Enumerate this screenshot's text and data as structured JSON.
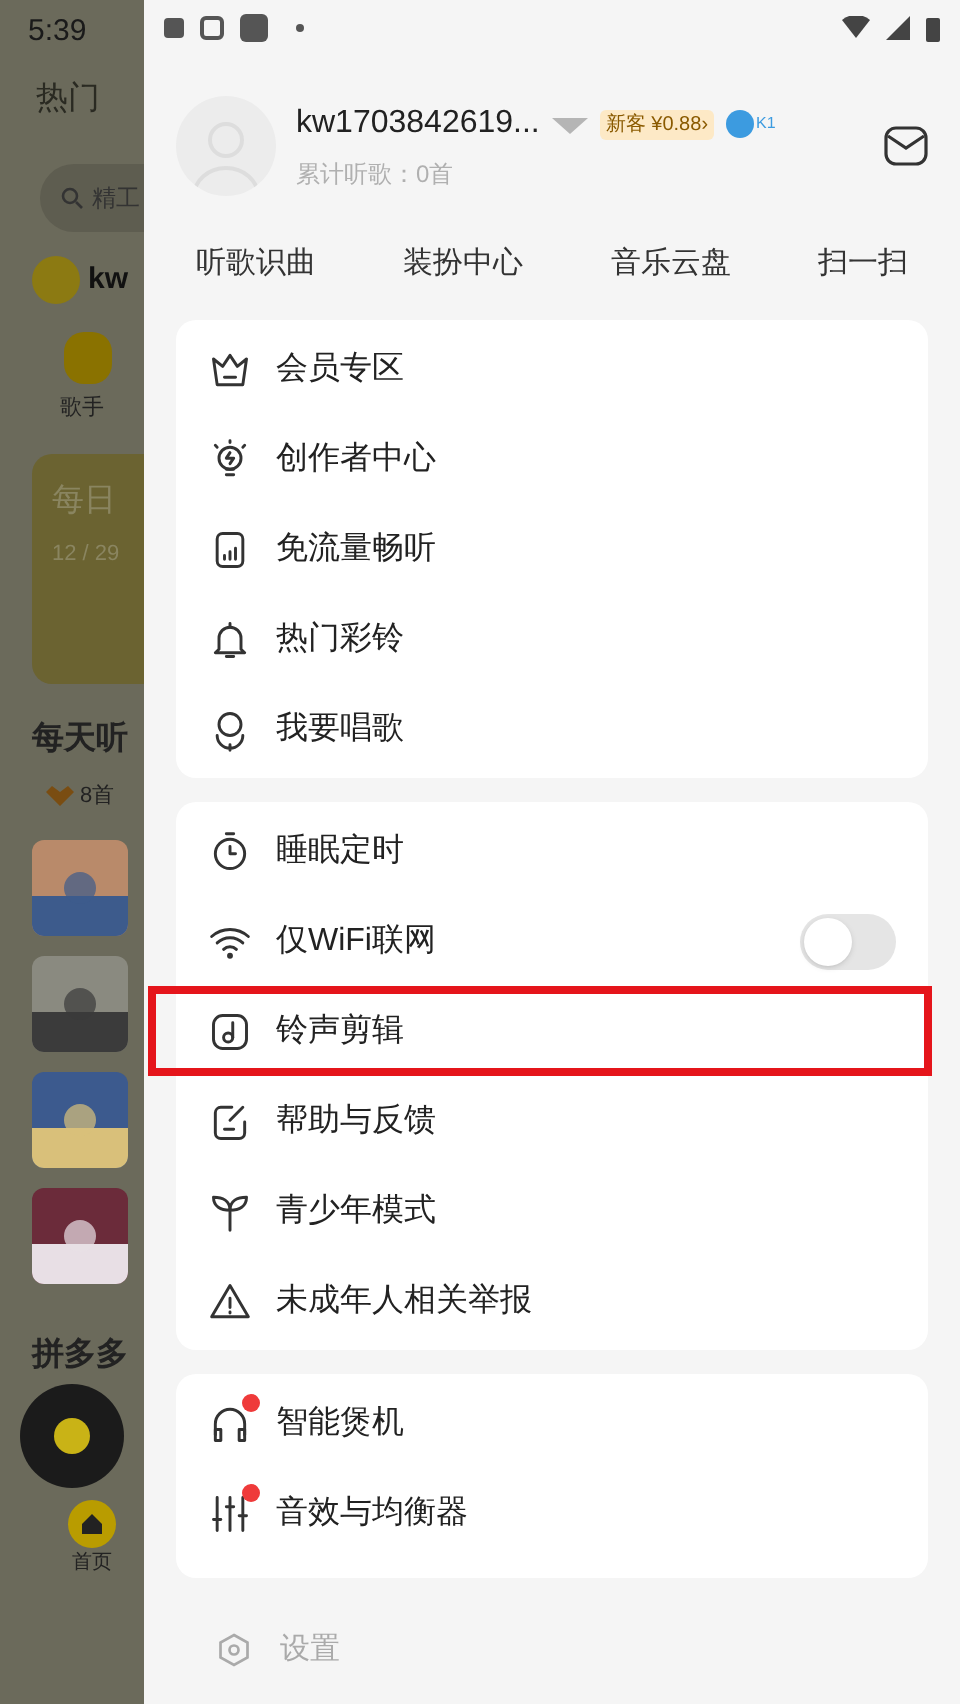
{
  "status_bar": {
    "time": "5:39"
  },
  "background_app": {
    "tab": "热门",
    "search": "精工",
    "user": "kw",
    "category": "歌手",
    "card_title": "每日",
    "card_date": "12 / 29",
    "section": "每天听",
    "count": "8首",
    "section_2": "拼多多",
    "nav": {
      "label": "首页",
      "selected": true
    }
  },
  "profile": {
    "username": "kw1703842619...",
    "promo": "新客 ¥0.88",
    "promo_arrow": "›",
    "level": "K1",
    "subtitle": "累计听歌：0首"
  },
  "quick_links": [
    "听歌识曲",
    "装扮中心",
    "音乐云盘",
    "扫一扫"
  ],
  "groups": [
    {
      "items": [
        {
          "label": "会员专区",
          "dot": false,
          "highlighted": false
        },
        {
          "label": "创作者中心",
          "dot": false,
          "highlighted": false
        },
        {
          "label": "免流量畅听",
          "dot": false,
          "highlighted": false
        },
        {
          "label": "热门彩铃",
          "dot": false,
          "highlighted": false
        },
        {
          "label": "我要唱歌",
          "dot": false,
          "highlighted": false
        }
      ]
    },
    {
      "items": [
        {
          "label": "睡眠定时",
          "dot": false,
          "highlighted": false
        },
        {
          "label": "仅WiFi联网",
          "dot": false,
          "highlighted": false,
          "on": false
        },
        {
          "label": "铃声剪辑",
          "dot": false,
          "highlighted": true
        },
        {
          "label": "帮助与反馈",
          "dot": false,
          "highlighted": false
        },
        {
          "label": "青少年模式",
          "dot": false,
          "highlighted": false
        },
        {
          "label": "未成年人相关举报",
          "dot": false,
          "highlighted": false
        }
      ]
    },
    {
      "items": [
        {
          "label": "智能煲机",
          "dot": true,
          "highlighted": false
        },
        {
          "label": "音效与均衡器",
          "dot": true,
          "highlighted": false
        }
      ]
    }
  ],
  "settings": {
    "label": "设置"
  }
}
